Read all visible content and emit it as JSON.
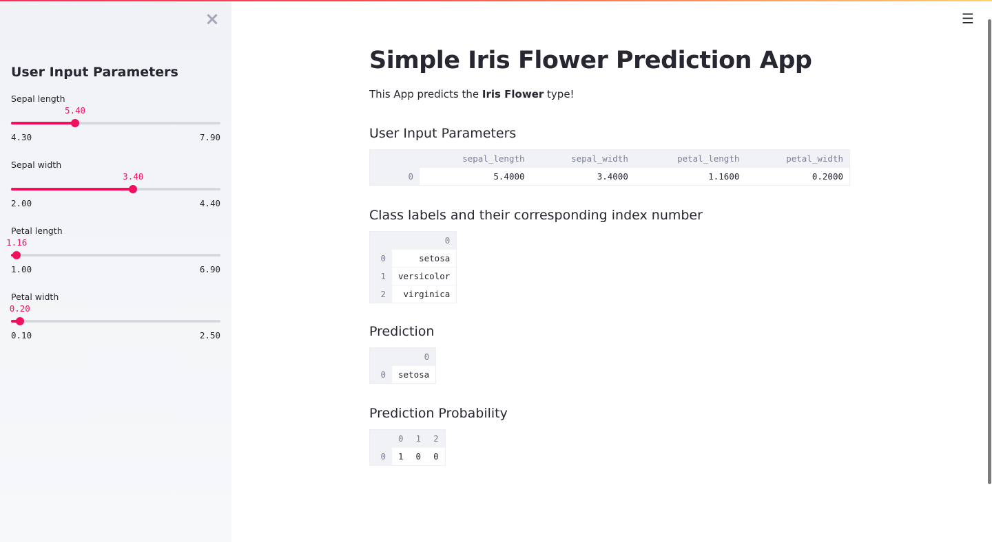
{
  "sidebar": {
    "close_icon": "×",
    "title": "User Input Parameters",
    "sliders": [
      {
        "label": "Sepal length",
        "value": "5.40",
        "min": "4.30",
        "max": "7.90",
        "fraction": 0.306
      },
      {
        "label": "Sepal width",
        "value": "3.40",
        "min": "2.00",
        "max": "4.40",
        "fraction": 0.583
      },
      {
        "label": "Petal length",
        "value": "1.16",
        "min": "1.00",
        "max": "6.90",
        "fraction": 0.027
      },
      {
        "label": "Petal width",
        "value": "0.20",
        "min": "0.10",
        "max": "2.50",
        "fraction": 0.042
      }
    ]
  },
  "header": {
    "menu_icon": "☰"
  },
  "main": {
    "title": "Simple Iris Flower Prediction App",
    "desc_pre": "This App predicts the ",
    "desc_bold": "Iris Flower",
    "desc_post": " type!",
    "input_section": {
      "heading": "User Input Parameters",
      "columns": [
        "sepal_length",
        "sepal_width",
        "petal_length",
        "petal_width"
      ],
      "rows": [
        {
          "index": "0",
          "cells": [
            "5.4000",
            "3.4000",
            "1.1600",
            "0.2000"
          ]
        }
      ]
    },
    "labels_section": {
      "heading": "Class labels and their corresponding index number",
      "column": "0",
      "rows": [
        {
          "index": "0",
          "value": "setosa"
        },
        {
          "index": "1",
          "value": "versicolor"
        },
        {
          "index": "2",
          "value": "virginica"
        }
      ]
    },
    "prediction_section": {
      "heading": "Prediction",
      "column": "0",
      "rows": [
        {
          "index": "0",
          "value": "setosa"
        }
      ]
    },
    "probability_section": {
      "heading": "Prediction Probability",
      "columns": [
        "0",
        "1",
        "2"
      ],
      "rows": [
        {
          "index": "0",
          "cells": [
            "1",
            "0",
            "0"
          ]
        }
      ]
    }
  },
  "colors": {
    "accent": "#f0115e",
    "sidebar_bg": "#f0f2f6",
    "text": "#262730"
  }
}
